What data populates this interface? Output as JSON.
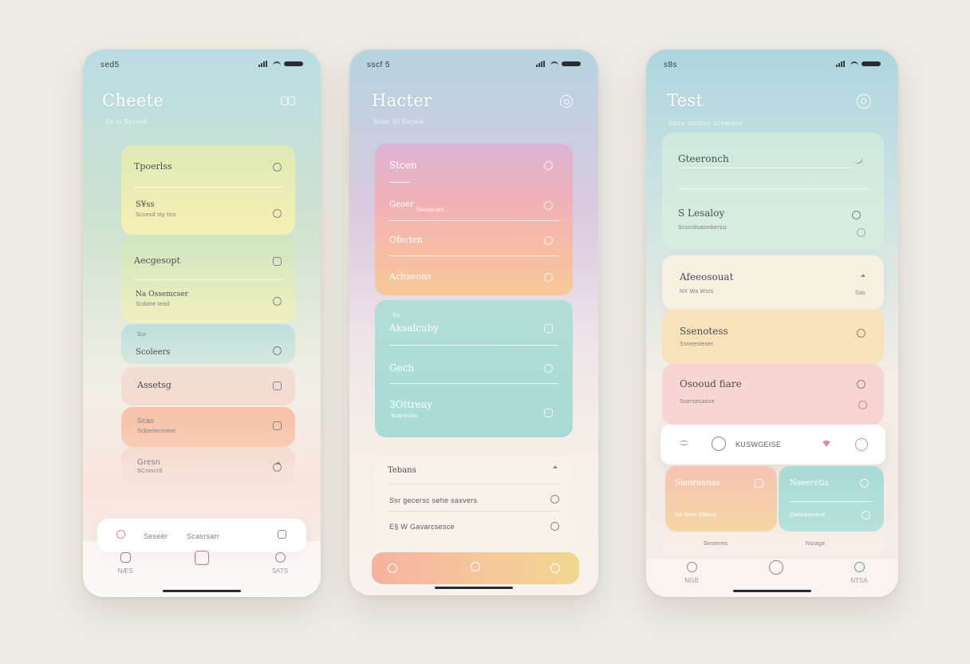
{
  "screens": [
    {
      "status": {
        "time": "sed5"
      },
      "title": "Cheete",
      "subtitle": "Ss sl Sccsed",
      "header_icon": "bow-icon",
      "cards": [
        {
          "title": "Tpoerlss",
          "sub": ""
        },
        {
          "title": "S¥ss",
          "sub": "Scsesd sty tics"
        },
        {
          "title": "Aecgesopt",
          "sub": ""
        },
        {
          "title": "Na Ossemcser",
          "sub": "Scdatie tead"
        },
        {
          "title": "Sur",
          "sub": ""
        },
        {
          "title": "Scoleers",
          "sub": ""
        },
        {
          "title": "A\u0010ssetsg",
          "sub": ""
        },
        {
          "title": "Scas",
          "sub": "Scbeelersneel"
        },
        {
          "title": "Gresn",
          "sub": "SCrsscrS"
        }
      ],
      "bottom_bar": {
        "left_label": "Seseër",
        "right_label": "Scasrsarr"
      },
      "tabs": [
        {
          "label": "NÆS"
        },
        {
          "label": ""
        },
        {
          "label": "SATS"
        }
      ]
    },
    {
      "status": {
        "time": "sscf 5"
      },
      "title": "Hacter",
      "subtitle": "Ssatr Sl Sscaia",
      "header_icon": "ring-icon",
      "pink_card": [
        {
          "title": "Stcen"
        },
        {
          "title": "Geoer",
          "sub": "Ssonscarc"
        },
        {
          "title": "Oferien"
        },
        {
          "title": "Achseons"
        }
      ],
      "teal_card": [
        {
          "title": "Aksalcuby",
          "sub": "Sic"
        },
        {
          "title": "Gech"
        },
        {
          "title": "3Ottreay",
          "sub": "Scarecies"
        }
      ],
      "list": [
        {
          "title": "Tebans"
        },
        {
          "title": "Ssr gecersc sehe saxvers"
        },
        {
          "title": "E§ W Gavarcsesce"
        }
      ]
    },
    {
      "status": {
        "time": "s8s"
      },
      "title": "Test",
      "subtitle": "Sbsa ssrtdes scearess",
      "header_icon": "target-icon",
      "green_card": [
        {
          "title": "Gteeronch"
        },
        {
          "title": "S Lesaloy",
          "sub": "Scscrdsasmkersiz"
        }
      ],
      "rows": [
        {
          "title": "Afeeosouat",
          "sub": "NX Wa Wsts",
          "badge": "Sas"
        },
        {
          "title": "Ssenotess",
          "sub": "Ssneesteser"
        },
        {
          "title": "Osooud fiare",
          "sub": "Ssersecatise"
        }
      ],
      "search": {
        "placeholder": "KUSWGEISE"
      },
      "mini_cards": [
        {
          "title": "Sienreanas",
          "sub": "Sa Neer Oasne"
        },
        {
          "title": "Nseeretis",
          "sub": "Oancavsrece"
        }
      ],
      "mini_footer": {
        "left": "Seserres",
        "right": "Nsrage"
      },
      "tabs": [
        {
          "label": "NGB"
        },
        {
          "label": ""
        },
        {
          "label": "NTSA"
        }
      ]
    }
  ],
  "colors": {
    "yellow": "#f4ecb6",
    "green": "#d7e8c3",
    "teal": "#b9e0da",
    "peach": "#f6c6ad",
    "pink": "#f3c7c6",
    "rose_gradient_top": "#e6b3d0",
    "rose_gradient_bottom": "#f6c39a",
    "accent_red": "#d86f7c"
  }
}
